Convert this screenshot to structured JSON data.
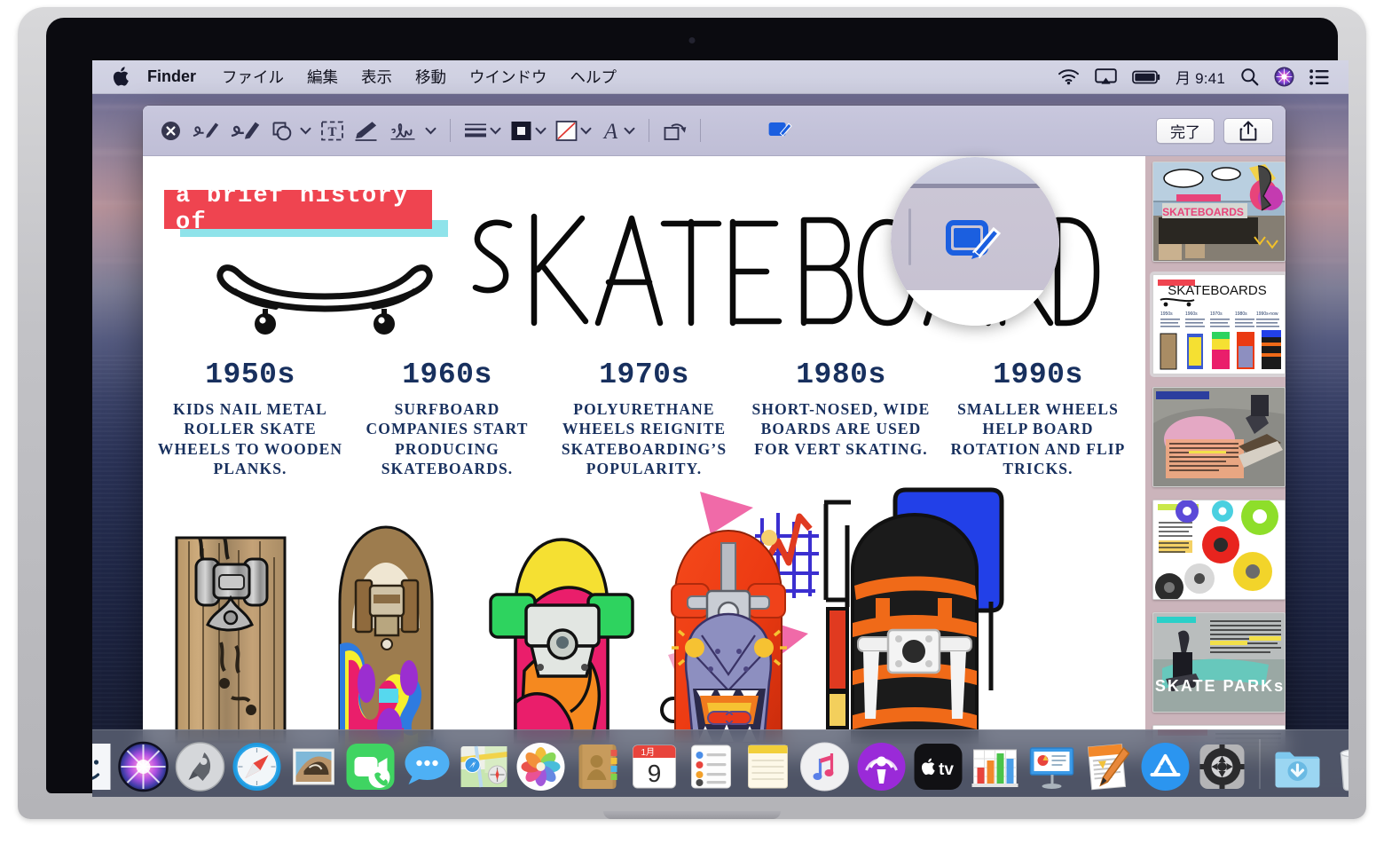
{
  "menubar": {
    "apple_icon": "apple-logo",
    "items": [
      {
        "label": "Finder",
        "bold": true
      },
      {
        "label": "ファイル",
        "bold": false
      },
      {
        "label": "編集",
        "bold": false
      },
      {
        "label": "表示",
        "bold": false
      },
      {
        "label": "移動",
        "bold": false
      },
      {
        "label": "ウインドウ",
        "bold": false
      },
      {
        "label": "ヘルプ",
        "bold": false
      }
    ],
    "status": {
      "wifi_icon": "wifi-icon",
      "airplay_icon": "airplay-icon",
      "battery_icon": "battery-icon",
      "clock": "月 9:41",
      "search_icon": "search-icon",
      "siri_icon": "siri-icon",
      "control_center_icon": "control-center-icon"
    }
  },
  "window": {
    "toolbar": {
      "tools": [
        {
          "name": "close-markup",
          "icon": "circle-x-icon",
          "chevron": false
        },
        {
          "name": "sketch-tool",
          "icon": "sketch-pencil-icon",
          "chevron": false
        },
        {
          "name": "draw-tool",
          "icon": "draw-marker-icon",
          "chevron": false
        },
        {
          "name": "shapes-tool",
          "icon": "shapes-icon",
          "chevron": true
        },
        {
          "name": "text-tool",
          "icon": "text-box-icon",
          "chevron": false
        },
        {
          "name": "highlight-tool",
          "icon": "highlighter-icon",
          "chevron": false
        },
        {
          "name": "sign-tool",
          "icon": "signature-icon",
          "chevron": true
        },
        {
          "name": "shape-style",
          "icon": "line-weight-icon",
          "chevron": true
        },
        {
          "name": "border-color",
          "icon": "border-color-icon",
          "chevron": true
        },
        {
          "name": "fill-color",
          "icon": "fill-color-icon",
          "chevron": true
        },
        {
          "name": "text-style",
          "icon": "font-a-icon",
          "chevron": true
        },
        {
          "name": "rotate-left",
          "icon": "rotate-icon",
          "chevron": false
        },
        {
          "name": "markup-toggle",
          "icon": "markup-pencil-icon",
          "chevron": false
        }
      ],
      "done_label": "完了",
      "share_icon": "share-icon"
    },
    "callout": {
      "highlighted_tool": "markup-pencil-icon",
      "accent_color": "#1B5FE0"
    },
    "sidebar": {
      "thumbnails": [
        {
          "name": "thumb-cover-skatepark",
          "selected": false
        },
        {
          "name": "thumb-skateboards-timeline",
          "selected": true
        },
        {
          "name": "thumb-origin-story",
          "selected": false
        },
        {
          "name": "thumb-wheels",
          "selected": false
        },
        {
          "name": "thumb-skate-parks",
          "selected": false
        },
        {
          "name": "thumb-last-page",
          "selected": false
        }
      ],
      "background_color": "#CBB4BB"
    }
  },
  "document": {
    "kicker": "a brief history of",
    "title": "SKATEBOARDS",
    "kicker_bg": "#EF4450",
    "kicker_underline": "#8FE3EA",
    "text_color": "#18305E",
    "decades": [
      {
        "year": "1950s",
        "body": "KIDS NAIL METAL ROLLER SKATE WHEELS TO WOODEN PLANKS."
      },
      {
        "year": "1960s",
        "body": "SURFBOARD COMPANIES START PRODUCING SKATEBOARDS."
      },
      {
        "year": "1970s",
        "body": "POLYURETHANE WHEELS REIGNITE SKATEBOARDING’S POPULARITY."
      },
      {
        "year": "1980s",
        "body": "SHORT-NOSED, WIDE BOARDS ARE USED FOR VERT SKATING."
      },
      {
        "year": "1990s",
        "body": "SMALLER WHEELS HELP BOARD ROTATION AND FLIP TRICKS."
      }
    ]
  },
  "dock": {
    "items": [
      {
        "name": "dock-finder",
        "label": "Finder",
        "running": true
      },
      {
        "name": "dock-siri",
        "label": "Siri",
        "running": false
      },
      {
        "name": "dock-launchpad",
        "label": "Launchpad",
        "running": false
      },
      {
        "name": "dock-safari",
        "label": "Safari",
        "running": false
      },
      {
        "name": "dock-mail",
        "label": "Mail",
        "running": false
      },
      {
        "name": "dock-facetime",
        "label": "FaceTime",
        "running": false
      },
      {
        "name": "dock-messages",
        "label": "Messages",
        "running": false
      },
      {
        "name": "dock-maps",
        "label": "Maps",
        "running": false
      },
      {
        "name": "dock-photos",
        "label": "Photos",
        "running": false
      },
      {
        "name": "dock-contacts",
        "label": "Contacts",
        "running": false
      },
      {
        "name": "dock-calendar",
        "label": "Calendar",
        "running": false,
        "month": "1月",
        "day": "9"
      },
      {
        "name": "dock-reminders",
        "label": "Reminders",
        "running": false
      },
      {
        "name": "dock-notes",
        "label": "Notes",
        "running": false
      },
      {
        "name": "dock-itunes",
        "label": "iTunes",
        "running": false
      },
      {
        "name": "dock-podcasts",
        "label": "Podcasts",
        "running": false
      },
      {
        "name": "dock-appletv",
        "label": "TV",
        "running": false
      },
      {
        "name": "dock-numbers",
        "label": "Numbers",
        "running": false
      },
      {
        "name": "dock-keynote",
        "label": "Keynote",
        "running": false
      },
      {
        "name": "dock-pages",
        "label": "Pages",
        "running": false
      },
      {
        "name": "dock-appstore",
        "label": "App Store",
        "running": false
      },
      {
        "name": "dock-system-preferences",
        "label": "System Preferences",
        "running": false
      },
      {
        "name": "dock-downloads",
        "label": "Downloads",
        "running": false
      },
      {
        "name": "dock-trash",
        "label": "Trash",
        "running": false
      }
    ]
  }
}
